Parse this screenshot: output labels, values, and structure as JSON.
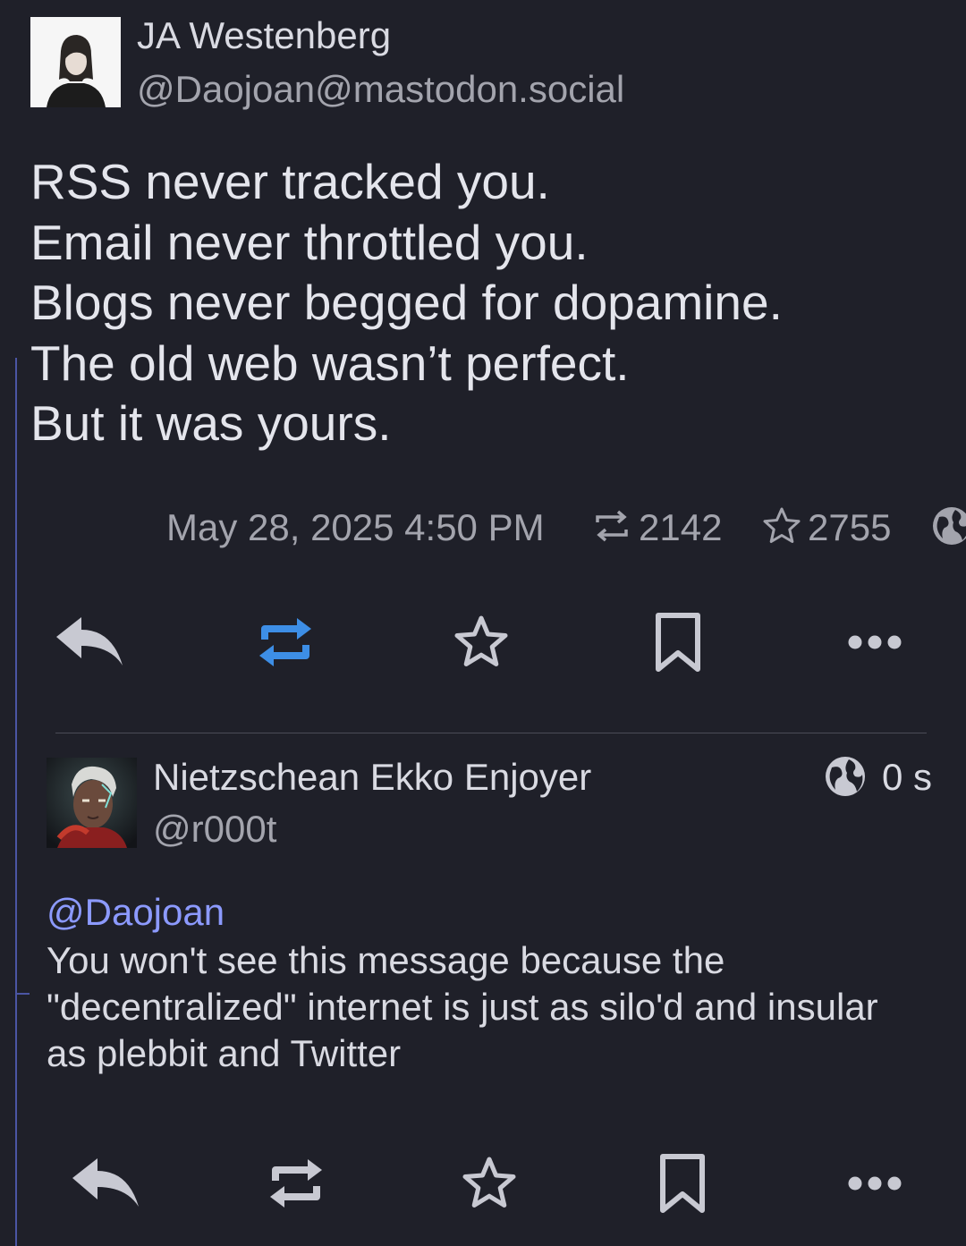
{
  "post": {
    "display_name": "JA Westenberg",
    "handle": "@Daojoan@mastodon.social",
    "content_lines": [
      "RSS never tracked you.",
      "Email never throttled you.",
      "Blogs never begged for dopamine.",
      "The old web wasn’t perfect.",
      "But it was yours."
    ],
    "timestamp": "May 28, 2025 4:50 PM",
    "boost_count": "2142",
    "favourite_count": "2755",
    "boosted": true,
    "boost_active_color": "#3d8ee6"
  },
  "reply": {
    "display_name": "Nietzschean Ekko Enjoyer",
    "handle": "@r000t",
    "relative_time": "0 s",
    "mention": "@Daojoan",
    "content_lines": [
      "You won't see this message because the",
      "\"decentralized\" internet is just as silo'd and insular",
      "as plebbit and Twitter"
    ]
  },
  "icons": {
    "reply": "reply-icon",
    "boost": "boost-icon",
    "favourite": "star-icon",
    "bookmark": "bookmark-icon",
    "more": "more-icon",
    "visibility": "globe-icon"
  },
  "colors": {
    "background": "#1f2029",
    "thread_line": "#4b55a3",
    "mention": "#8c9aff",
    "icon": "#c8c9d2"
  }
}
